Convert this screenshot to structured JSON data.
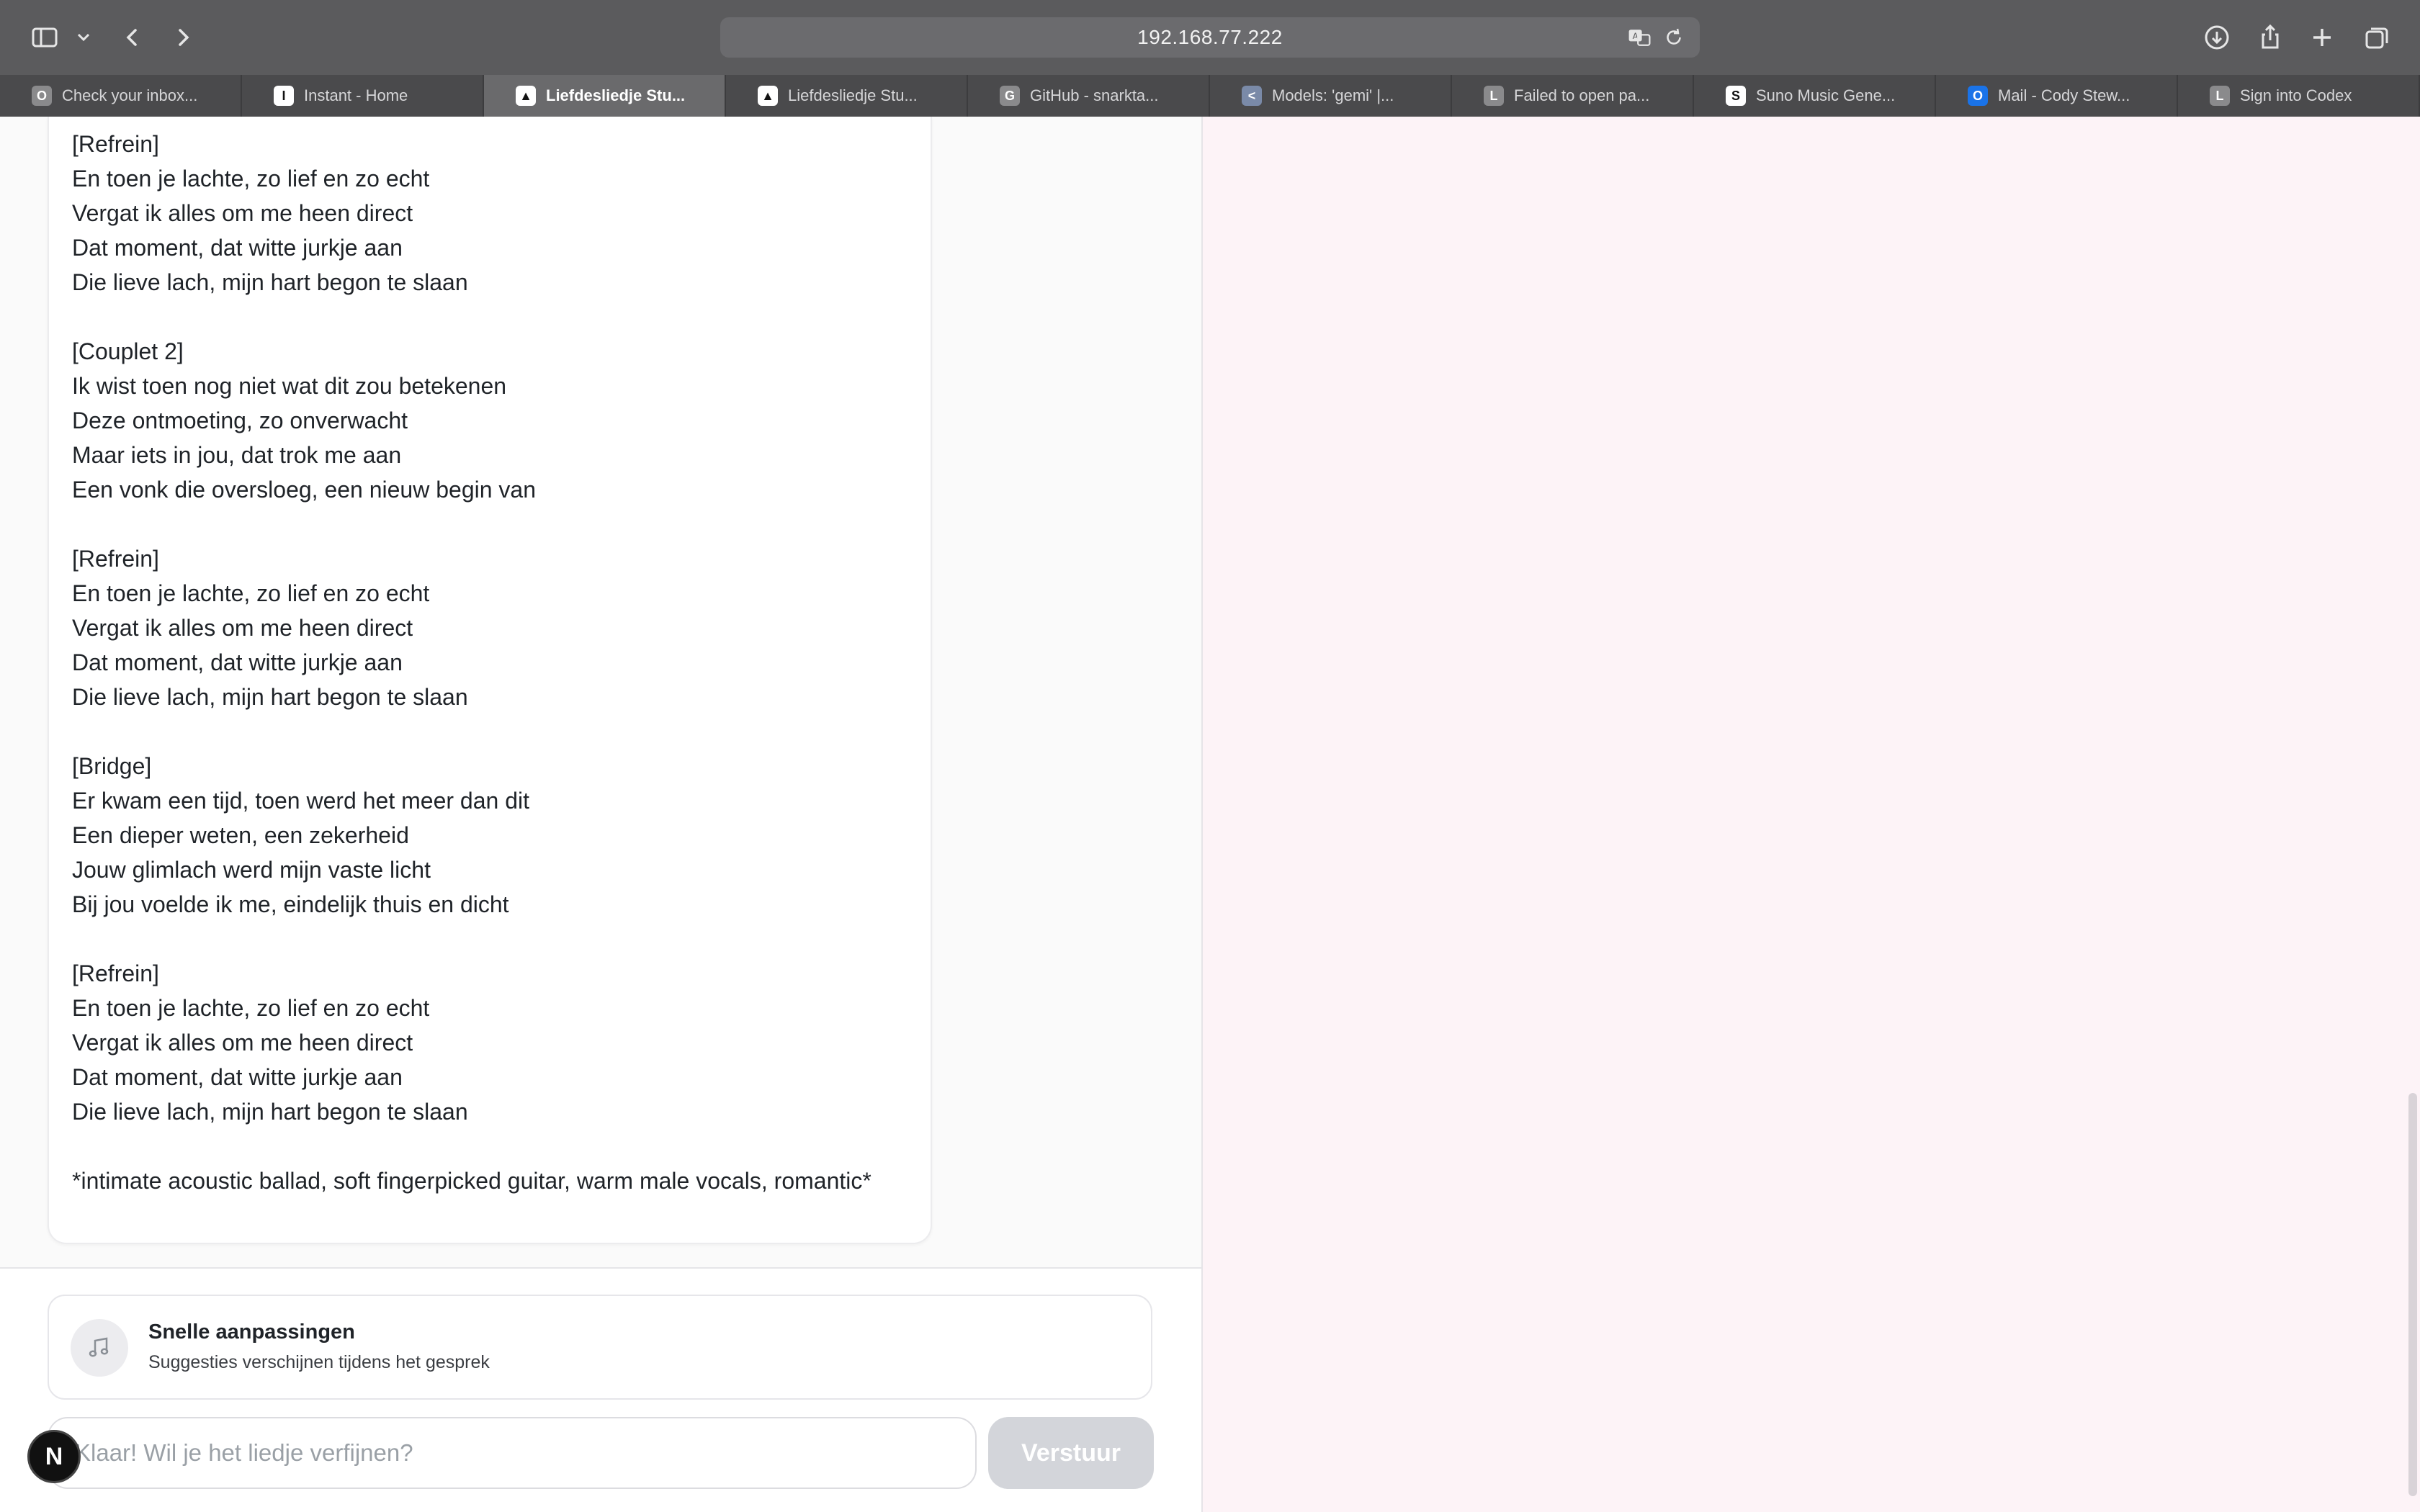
{
  "browser": {
    "url": "192.168.77.222",
    "tabs": [
      {
        "label": "Check your inbox...",
        "favicon": "O",
        "color": "#8a8a8c"
      },
      {
        "label": "Instant - Home",
        "favicon": "I",
        "color": "#ffffff"
      },
      {
        "label": "Liefdesliedje Stu...",
        "favicon": "▲",
        "color": "#ffffff"
      },
      {
        "label": "Liefdesliedje Stu...",
        "favicon": "▲",
        "color": "#ffffff"
      },
      {
        "label": "GitHub - snarkta...",
        "favicon": "G",
        "color": "#8a8a8c"
      },
      {
        "label": "Models: 'gemi' |...",
        "favicon": "<",
        "color": "#7a8aa8"
      },
      {
        "label": "Failed to open pa...",
        "favicon": "L",
        "color": "#8a8a8c"
      },
      {
        "label": "Suno Music Gene...",
        "favicon": "S",
        "color": "#ffffff"
      },
      {
        "label": "Mail - Cody Stew...",
        "favicon": "O",
        "color": "#1a73e8"
      },
      {
        "label": "Sign into Codex",
        "favicon": "L",
        "color": "#8a8a8c"
      }
    ],
    "active_tab": 2
  },
  "lyrics": {
    "stanzas": [
      [
        "[Refrein]",
        "En toen je lachte, zo lief en zo echt",
        "Vergat ik alles om me heen direct",
        "Dat moment, dat witte jurkje aan",
        "Die lieve lach, mijn hart begon te slaan"
      ],
      [
        "[Couplet 2]",
        "Ik wist toen nog niet wat dit zou betekenen",
        "Deze ontmoeting, zo onverwacht",
        "Maar iets in jou, dat trok me aan",
        "Een vonk die oversloeg, een nieuw begin van"
      ],
      [
        "[Refrein]",
        "En toen je lachte, zo lief en zo echt",
        "Vergat ik alles om me heen direct",
        "Dat moment, dat witte jurkje aan",
        "Die lieve lach, mijn hart begon te slaan"
      ],
      [
        "[Bridge]",
        "Er kwam een tijd, toen werd het meer dan dit",
        "Een dieper weten, een zekerheid",
        "Jouw glimlach werd mijn vaste licht",
        "Bij jou voelde ik me, eindelijk thuis en dicht"
      ],
      [
        "[Refrein]",
        "En toen je lachte, zo lief en zo echt",
        "Vergat ik alles om me heen direct",
        "Dat moment, dat witte jurkje aan",
        "Die lieve lach, mijn hart begon te slaan"
      ]
    ],
    "style_note": "*intimate acoustic ballad, soft fingerpicked guitar, warm male vocals, romantic*"
  },
  "quick_adjust": {
    "title": "Snelle aanpassingen",
    "subtitle": "Suggesties verschijnen tijdens het gesprek",
    "icon": "music-note-icon"
  },
  "composer": {
    "placeholder": "Klaar! Wil je het liedje verfijnen?",
    "value": "",
    "send_label": "Verstuur"
  },
  "badge": {
    "label": "N"
  }
}
